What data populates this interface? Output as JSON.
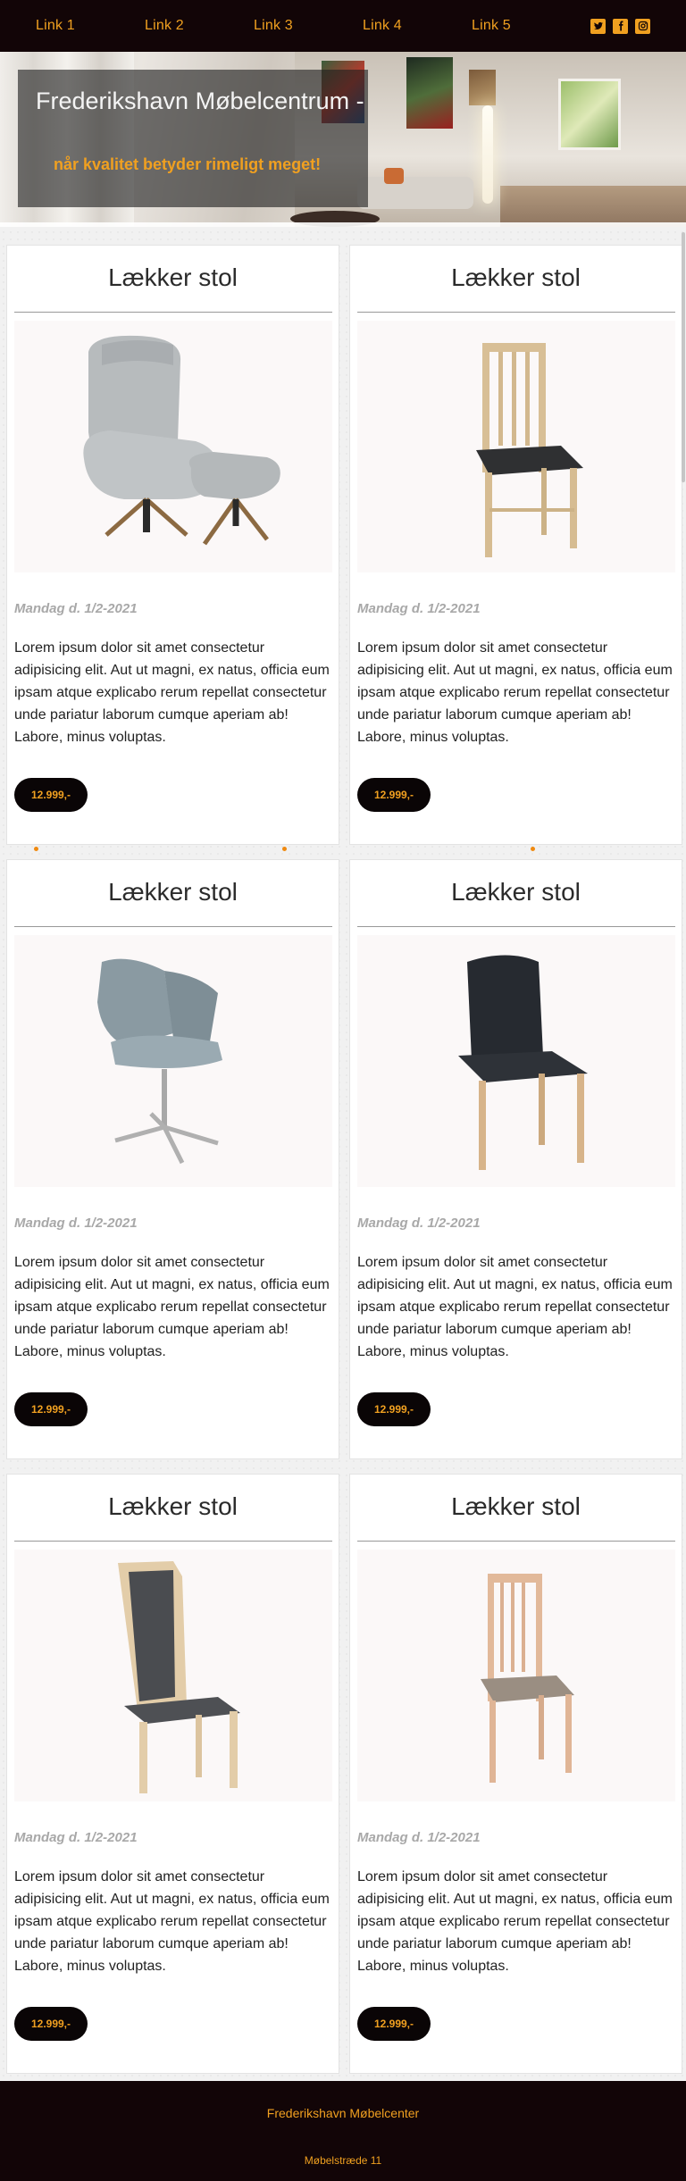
{
  "nav": {
    "links": [
      "Link 1",
      "Link 2",
      "Link 3",
      "Link 4",
      "Link 5"
    ],
    "social_icons": [
      "twitter-icon",
      "facebook-icon",
      "instagram-icon"
    ]
  },
  "hero": {
    "title": "Frederikshavn Møbelcentrum -",
    "tagline": "når kvalitet betyder rimeligt meget!"
  },
  "cards": [
    {
      "title": "Lækker stol",
      "image": "lounge-chair-with-footstool",
      "date": "Mandag d. 1/2-2021",
      "text": "Lorem ipsum dolor sit amet consectetur adipisicing elit. Aut ut magni, ex natus, officia eum ipsam atque explicabo rerum repellat consectetur unde pariatur laborum cumque aperiam ab! Labore, minus voluptas.",
      "price": "12.999,-"
    },
    {
      "title": "Lækker stol",
      "image": "wooden-dining-chair-black-seat",
      "date": "Mandag d. 1/2-2021",
      "text": "Lorem ipsum dolor sit amet consectetur adipisicing elit. Aut ut magni, ex natus, officia eum ipsam atque explicabo rerum repellat consectetur unde pariatur laborum cumque aperiam ab! Labore, minus voluptas.",
      "price": "12.999,-"
    },
    {
      "title": "Lækker stol",
      "image": "swivel-armchair-grey",
      "date": "Mandag d. 1/2-2021",
      "text": "Lorem ipsum dolor sit amet consectetur adipisicing elit. Aut ut magni, ex natus, officia eum ipsam atque explicabo rerum repellat consectetur unde pariatur laborum cumque aperiam ab! Labore, minus voluptas.",
      "price": "12.999,-"
    },
    {
      "title": "Lækker stol",
      "image": "leather-dining-chair-black",
      "date": "Mandag d. 1/2-2021",
      "text": "Lorem ipsum dolor sit amet consectetur adipisicing elit. Aut ut magni, ex natus, officia eum ipsam atque explicabo rerum repellat consectetur unde pariatur laborum cumque aperiam ab! Labore, minus voluptas.",
      "price": "12.999,-"
    },
    {
      "title": "Lækker stol",
      "image": "upholstered-dining-chair-dark-grey",
      "date": "Mandag d. 1/2-2021",
      "text": "Lorem ipsum dolor sit amet consectetur adipisicing elit. Aut ut magni, ex natus, officia eum ipsam atque explicabo rerum repellat consectetur unde pariatur laborum cumque aperiam ab! Labore, minus voluptas.",
      "price": "12.999,-"
    },
    {
      "title": "Lækker stol",
      "image": "wooden-dining-chair-taupe-seat",
      "date": "Mandag d. 1/2-2021",
      "text": "Lorem ipsum dolor sit amet consectetur adipisicing elit. Aut ut magni, ex natus, officia eum ipsam atque explicabo rerum repellat consectetur unde pariatur laborum cumque aperiam ab! Labore, minus voluptas.",
      "price": "12.999,-"
    }
  ],
  "footer": {
    "name": "Frederikshavn Møbelcenter",
    "address": "Møbelstræde 11"
  },
  "colors": {
    "nav_bg": "#120507",
    "accent": "#f0a020",
    "button_bg": "#0a0506"
  }
}
